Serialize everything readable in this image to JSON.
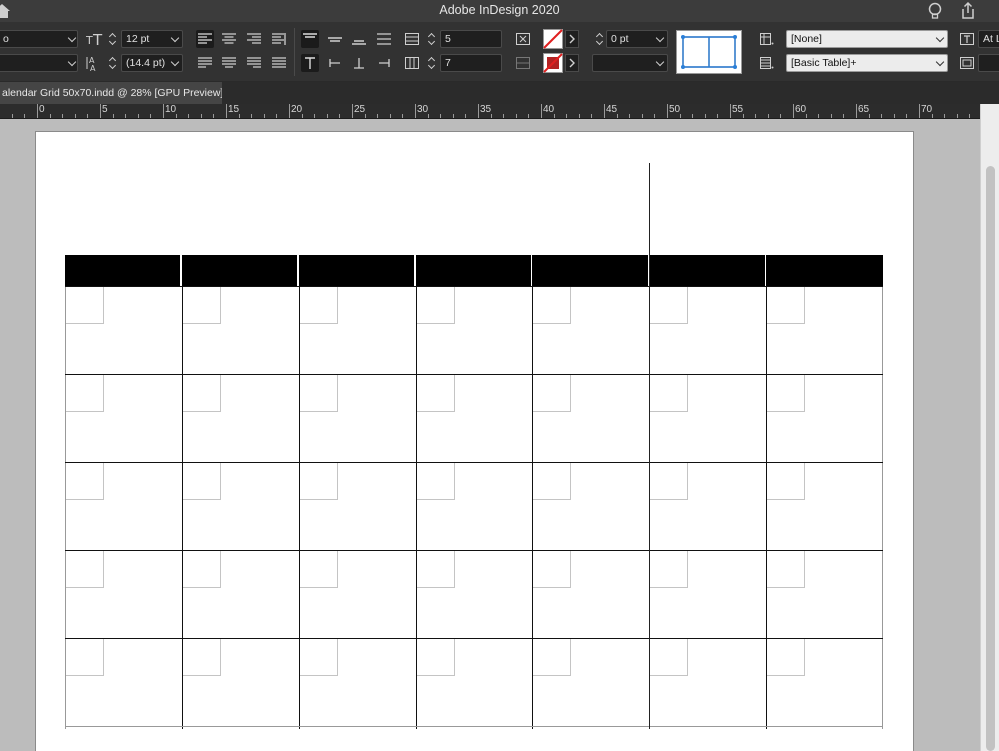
{
  "window": {
    "title": "Adobe InDesign 2020",
    "icons": [
      "home-icon",
      "lightbulb-icon",
      "share-icon"
    ]
  },
  "control_panel": {
    "row1": {
      "font_field_partial": "o",
      "font_size": "12 pt",
      "rows_count": "5",
      "stroke_weight": "0 pt",
      "cell_style": "[None]",
      "text_option_partial": "At L"
    },
    "row2": {
      "leading": "(14.4 pt)",
      "columns_count": "7",
      "table_style": "[Basic Table]+"
    }
  },
  "document": {
    "tab_title": "alendar Grid 50x70.indd @ 28% [GPU Preview]"
  },
  "ruler": {
    "labels": [
      "0",
      "5",
      "10",
      "15",
      "20",
      "25",
      "30",
      "35",
      "40",
      "45",
      "50",
      "55",
      "60",
      "65",
      "70"
    ]
  },
  "calendar_table": {
    "columns": 7,
    "body_rows": 5,
    "header_color": "#000000"
  }
}
